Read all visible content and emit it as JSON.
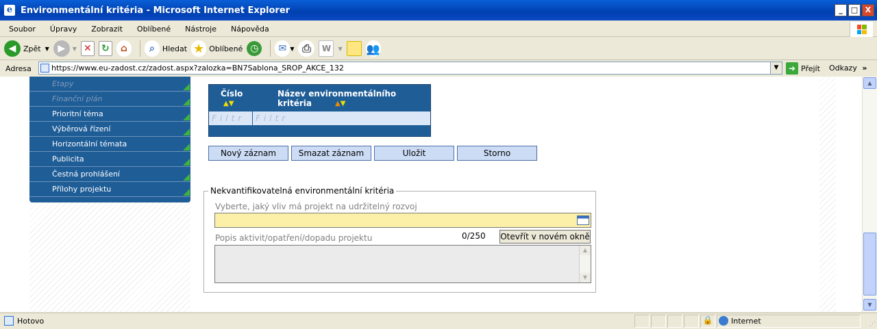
{
  "window": {
    "title": "Environmentální kritéria - Microsoft Internet Explorer",
    "minimize": "_",
    "maximize": "□",
    "close": "X"
  },
  "menu": [
    "Soubor",
    "Úpravy",
    "Zobrazit",
    "Oblíbené",
    "Nástroje",
    "Nápověda"
  ],
  "toolbar": {
    "back": "Zpět",
    "search": "Hledat",
    "favorites": "Oblíbené"
  },
  "address": {
    "label": "Adresa",
    "url": "https://www.eu-zadost.cz/zadost.aspx?zalozka=BN7Sablona_SROP_AKCE_132",
    "go": "Přejít",
    "links": "Odkazy"
  },
  "sidebar": {
    "items": [
      {
        "label": "Etapy",
        "disabled": true
      },
      {
        "label": "Finanční plán",
        "disabled": true
      },
      {
        "label": "Prioritní téma",
        "disabled": false
      },
      {
        "label": "Výběrová řízení",
        "disabled": false
      },
      {
        "label": "Horizontální témata",
        "disabled": false
      },
      {
        "label": "Publicita",
        "disabled": false
      },
      {
        "label": "Čestná prohlášení",
        "disabled": false
      },
      {
        "label": "Přílohy projektu",
        "disabled": false
      }
    ]
  },
  "grid": {
    "col_number": "Číslo",
    "col_name": "Název environmentálního kritéria",
    "filter_placeholder": "Filtr"
  },
  "actions": {
    "new": "Nový záznam",
    "delete": "Smazat záznam",
    "save": "Uložit",
    "cancel": "Storno"
  },
  "form": {
    "legend": "Nekvantifikovatelná environmentální kritéria",
    "select_label": "Vyberte, jaký vliv má projekt na udržitelný rozvoj",
    "select_value": "",
    "description_label": "Popis aktivit/opatření/dopadu projektu",
    "char_count": "0/250",
    "open_window": "Otevřít v novém okně",
    "description_value": ""
  },
  "status": {
    "text": "Hotovo",
    "zone": "Internet"
  },
  "colors": {
    "nav_bg": "#1f5d97",
    "select_bg": "#fcf0a8",
    "button_bg": "#ccdcf5"
  }
}
